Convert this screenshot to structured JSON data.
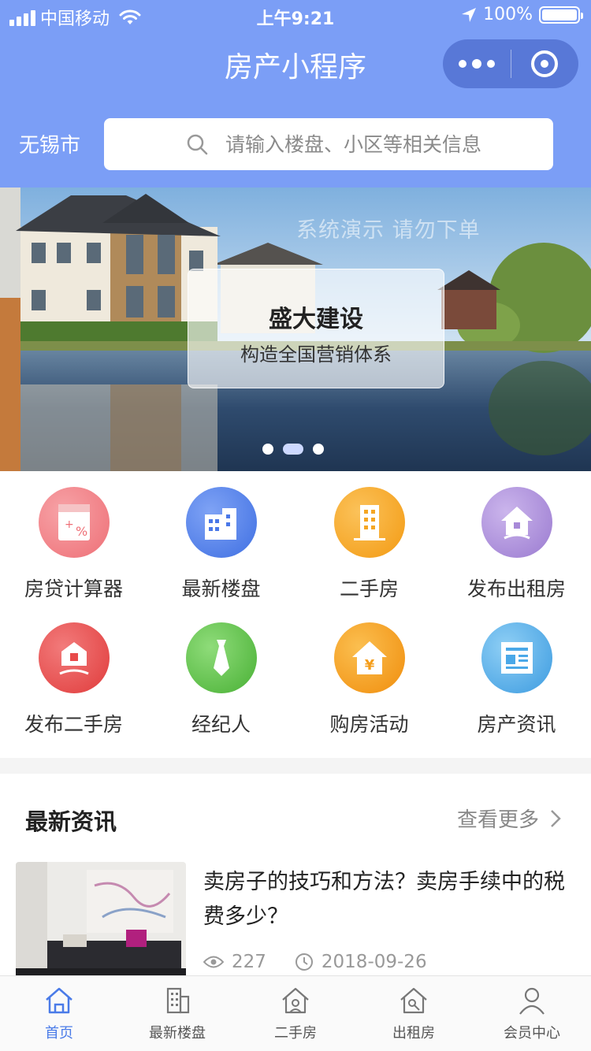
{
  "status_bar": {
    "carrier": "中国移动",
    "time": "上午9:21",
    "battery": "100%"
  },
  "header": {
    "title": "房产小程序",
    "city": "无锡市",
    "search_placeholder": "请输入楼盘、小区等相关信息"
  },
  "banner": {
    "watermark": "系统演示 请勿下单",
    "headline": "盛大建设",
    "subtitle": "构造全国营销体系",
    "slide_count": 3,
    "active_slide": 2
  },
  "features": [
    {
      "label": "房贷计算器",
      "icon": "calculator-icon",
      "color": "#ee6f76"
    },
    {
      "label": "最新楼盘",
      "icon": "building-icon",
      "color": "#4a78e8"
    },
    {
      "label": "二手房",
      "icon": "apartment-icon",
      "color": "#f5a623"
    },
    {
      "label": "发布出租房",
      "icon": "rent-house-icon",
      "color": "#a88ad8"
    },
    {
      "label": "发布二手房",
      "icon": "sell-house-icon",
      "color": "#e84a4a"
    },
    {
      "label": "经纪人",
      "icon": "tie-icon",
      "color": "#5cc24a"
    },
    {
      "label": "购房活动",
      "icon": "yuan-house-icon",
      "color": "#f59e1b"
    },
    {
      "label": "房产资讯",
      "icon": "news-icon",
      "color": "#4aa8e8"
    }
  ],
  "news": {
    "section_title": "最新资讯",
    "more_label": "查看更多",
    "items": [
      {
        "title": "卖房子的技巧和方法？卖房手续中的税费多少？",
        "views": "227",
        "date": "2018-09-26"
      }
    ]
  },
  "tabbar": {
    "items": [
      {
        "label": "首页",
        "icon": "home-icon",
        "active": true
      },
      {
        "label": "最新楼盘",
        "icon": "building-icon",
        "active": false
      },
      {
        "label": "二手房",
        "icon": "house-icon",
        "active": false
      },
      {
        "label": "出租房",
        "icon": "rent-icon",
        "active": false
      },
      {
        "label": "会员中心",
        "icon": "user-icon",
        "active": false
      }
    ]
  },
  "colors": {
    "header_bg": "#7b9ef6",
    "tab_active": "#4a7be8"
  }
}
